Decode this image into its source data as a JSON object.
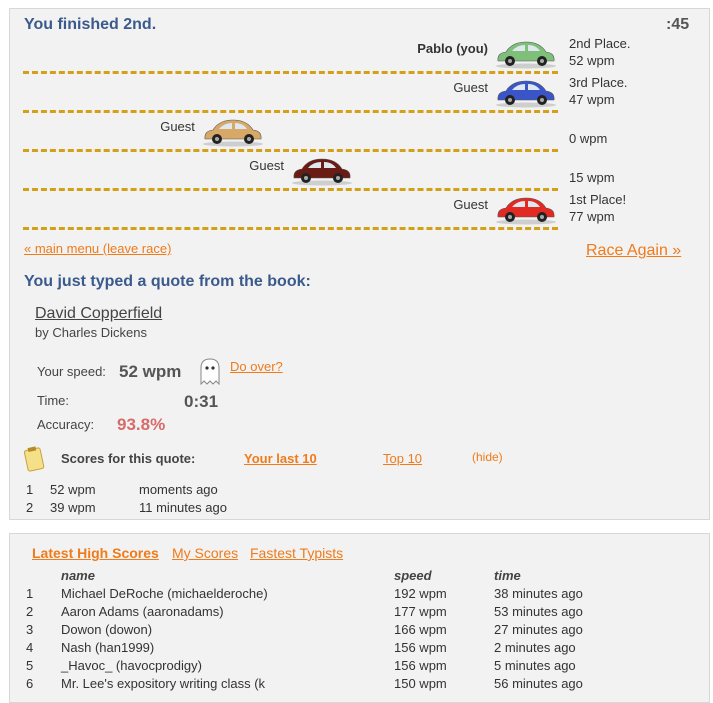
{
  "race": {
    "status_title": "You finished 2nd.",
    "timer": ":45",
    "racers": [
      {
        "name": "Pablo (you)",
        "bold": true,
        "color": "#7ec07a",
        "progress": 1.0,
        "result_line1": "2nd Place.",
        "result_line2": "52 wpm"
      },
      {
        "name": "Guest",
        "bold": false,
        "color": "#3a55c8",
        "progress": 1.0,
        "result_line1": "3rd Place.",
        "result_line2": "47 wpm"
      },
      {
        "name": "Guest",
        "bold": false,
        "color": "#d8a867",
        "progress": 0.21,
        "result_line1": "",
        "result_line2": "0 wpm"
      },
      {
        "name": "Guest",
        "bold": false,
        "color": "#6a1c14",
        "progress": 0.45,
        "result_line1": "",
        "result_line2": "15 wpm"
      },
      {
        "name": "Guest",
        "bold": false,
        "color": "#e22a22",
        "progress": 1.0,
        "result_line1": "1st Place!",
        "result_line2": "77 wpm"
      }
    ],
    "main_menu_link": "« main menu (leave race)",
    "race_again_link": "Race Again »"
  },
  "quote": {
    "heading": "You just typed a quote from the book:",
    "book_title": "David Copperfield",
    "book_author": "by Charles Dickens",
    "speed_label": "Your speed:",
    "speed_value": "52 wpm",
    "do_over_link": "Do over?",
    "time_label": "Time:",
    "time_value": "0:31",
    "accuracy_label": "Accuracy:",
    "accuracy_value": "93.8%"
  },
  "scores": {
    "label": "Scores for this quote:",
    "tab_last10": "Your last 10",
    "tab_top10": "Top 10",
    "hide": "(hide)",
    "rows": [
      {
        "rank": "1",
        "speed": "52 wpm",
        "when": "moments ago"
      },
      {
        "rank": "2",
        "speed": "39 wpm",
        "when": "11 minutes ago"
      }
    ]
  },
  "high_scores": {
    "tabs": [
      "Latest High Scores",
      "My Scores",
      "Fastest Typists"
    ],
    "columns": {
      "name": "name",
      "speed": "speed",
      "time": "time"
    },
    "rows": [
      {
        "rank": "1",
        "name": "Michael DeRoche (michaelderoche)",
        "speed": "192 wpm",
        "time": "38 minutes ago"
      },
      {
        "rank": "2",
        "name": "Aaron Adams (aaronadams)",
        "speed": "177 wpm",
        "time": "53 minutes ago"
      },
      {
        "rank": "3",
        "name": "Dowon (dowon)",
        "speed": "166 wpm",
        "time": "27 minutes ago"
      },
      {
        "rank": "4",
        "name": "Nash (han1999)",
        "speed": "156 wpm",
        "time": "2 minutes ago"
      },
      {
        "rank": "5",
        "name": "_Havoc_ (havocprodigy)",
        "speed": "156 wpm",
        "time": "5 minutes ago"
      },
      {
        "rank": "6",
        "name": "Mr. Lee's expository writing class (k",
        "speed": "150 wpm",
        "time": "56 minutes ago"
      }
    ]
  },
  "colors": {
    "accent": "#ef7b1a",
    "title": "#3b5a8c",
    "dash": "#d4a017",
    "accuracy": "#d86a6a"
  }
}
